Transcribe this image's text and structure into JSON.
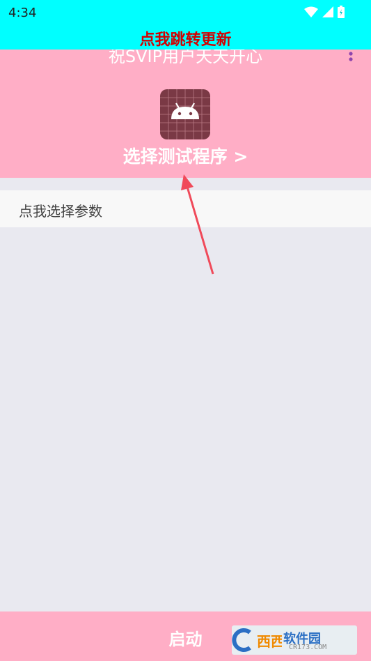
{
  "status": {
    "time": "4:34"
  },
  "banner": {
    "update_text": "点我跳转更新"
  },
  "header": {
    "greeting": "祝SVIP用户天天开心",
    "select_program": "选择测试程序 >"
  },
  "params": {
    "label": "点我选择参数"
  },
  "footer": {
    "start_label": "启动"
  },
  "watermark": {
    "brand": "软件园",
    "sub": "CR173.COM"
  },
  "colors": {
    "status_bg": "#00ffff",
    "update_text": "#d20000",
    "header_bg": "#ffaec6",
    "arrow": "#f04a5a",
    "page_bg": "#e9e9f0"
  }
}
